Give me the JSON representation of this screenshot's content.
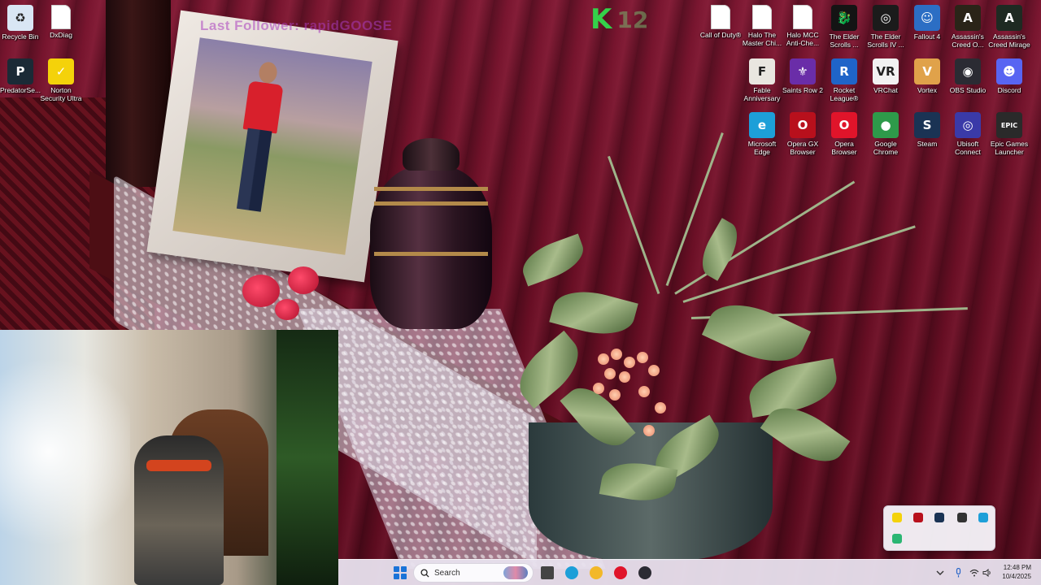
{
  "overlay": {
    "last_follower": "Last Follower: rapidGOOSE",
    "channel_k": "K",
    "channel_number": "12"
  },
  "desktop_left": [
    {
      "name": "recycle-bin",
      "label": "Recycle Bin",
      "icon": "recycle-bin-icon",
      "color": "#d9e6f4",
      "glyph": "♻"
    },
    {
      "name": "dxdiag",
      "label": "DxDiag",
      "icon": "file-icon",
      "color": "#ffffff",
      "glyph": ""
    },
    {
      "name": "predatorsense",
      "label": "PredatorSe...",
      "icon": "predator-icon",
      "color": "#1b2a36",
      "glyph": "P"
    },
    {
      "name": "norton",
      "label": "Norton Security Ultra",
      "icon": "norton-icon",
      "color": "#f4d20a",
      "glyph": "✓"
    }
  ],
  "desktop_right": [
    {
      "name": "call-of-duty",
      "label": "Call of Duty®",
      "icon": "file-icon",
      "color": "#ffffff",
      "glyph": ""
    },
    {
      "name": "halo-master-chief",
      "label": "Halo The Master Chi...",
      "icon": "file-icon",
      "color": "#ffffff",
      "glyph": ""
    },
    {
      "name": "halo-mcc",
      "label": "Halo MCC Anti-Che...",
      "icon": "file-icon",
      "color": "#ffffff",
      "glyph": ""
    },
    {
      "name": "elder-scrolls",
      "label": "The Elder Scrolls ...",
      "icon": "elder-scrolls-icon",
      "color": "#141414",
      "glyph": "🐉"
    },
    {
      "name": "elder-scrolls-iv",
      "label": "The Elder Scrolls IV ...",
      "icon": "oblivion-icon",
      "color": "#1b1b1b",
      "glyph": "◎"
    },
    {
      "name": "fallout4",
      "label": "Fallout 4",
      "icon": "vault-boy-icon",
      "color": "#2c6ec4",
      "glyph": "☺"
    },
    {
      "name": "assassins-creed-o",
      "label": "Assassin's Creed O...",
      "icon": "assassins-creed-icon",
      "color": "#2a2418",
      "glyph": "A"
    },
    {
      "name": "assassins-creed-mirage",
      "label": "Assassin's Creed Mirage",
      "icon": "assassins-creed-icon",
      "color": "#1e2a22",
      "glyph": "A"
    },
    {
      "name": "fable",
      "label": "Fable Anniversary",
      "icon": "fable-icon",
      "color": "#e9e6e0",
      "glyph": "F"
    },
    {
      "name": "saints-row",
      "label": "Saints Row 2",
      "icon": "fleur-de-lis-icon",
      "color": "#6a2da8",
      "glyph": "⚜"
    },
    {
      "name": "rocket-league",
      "label": "Rocket League®",
      "icon": "rocket-league-icon",
      "color": "#1f64c8",
      "glyph": "R"
    },
    {
      "name": "vrchat",
      "label": "VRChat",
      "icon": "vrchat-icon",
      "color": "#f2f2f2",
      "glyph": "VR"
    },
    {
      "name": "vortex",
      "label": "Vortex",
      "icon": "vortex-icon",
      "color": "#e0a24a",
      "glyph": "V"
    },
    {
      "name": "obs",
      "label": "OBS Studio",
      "icon": "obs-icon",
      "color": "#2b2b33",
      "glyph": "◉"
    },
    {
      "name": "discord",
      "label": "Discord",
      "icon": "discord-icon",
      "color": "#5865f2",
      "glyph": "☻"
    },
    {
      "name": "edge",
      "label": "Microsoft Edge",
      "icon": "edge-icon",
      "color": "#1d9fd8",
      "glyph": "e"
    },
    {
      "name": "opera-gx",
      "label": "Opera GX Browser",
      "icon": "opera-gx-icon",
      "color": "#b8101c",
      "glyph": "O"
    },
    {
      "name": "opera",
      "label": "Opera Browser",
      "icon": "opera-icon",
      "color": "#e0142a",
      "glyph": "O"
    },
    {
      "name": "chrome",
      "label": "Google Chrome",
      "icon": "chrome-icon",
      "color": "#2e9a4a",
      "glyph": "●"
    },
    {
      "name": "steam",
      "label": "Steam",
      "icon": "steam-icon",
      "color": "#1a3354",
      "glyph": "S"
    },
    {
      "name": "ubisoft",
      "label": "Ubisoft Connect",
      "icon": "ubisoft-icon",
      "color": "#3a3aa8",
      "glyph": "◎"
    },
    {
      "name": "epic",
      "label": "Epic Games Launcher",
      "icon": "epic-games-icon",
      "color": "#2a2a2a",
      "glyph": "EPIC"
    }
  ],
  "taskbar": {
    "search_label": "Search",
    "time": "12:48 PM",
    "date": "10/4/2025",
    "apps": [
      {
        "name": "taskview",
        "icon": "task-view-icon",
        "color": "#444"
      },
      {
        "name": "edge",
        "icon": "edge-icon",
        "color": "#1d9fd8"
      },
      {
        "name": "explorer",
        "icon": "folder-icon",
        "color": "#f2b829"
      },
      {
        "name": "opera",
        "icon": "opera-icon",
        "color": "#e0142a"
      },
      {
        "name": "obs",
        "icon": "obs-icon",
        "color": "#2b2b33"
      }
    ]
  },
  "tray_popup_icons": [
    {
      "name": "norton-tray",
      "color": "#f4d20a"
    },
    {
      "name": "opera-gx-tray",
      "color": "#b8101c"
    },
    {
      "name": "steam-tray",
      "color": "#1a3354"
    },
    {
      "name": "predator-tray",
      "color": "#333"
    },
    {
      "name": "edge-tray",
      "color": "#1d9fd8"
    },
    {
      "name": "app-tray",
      "color": "#2bb673"
    }
  ]
}
